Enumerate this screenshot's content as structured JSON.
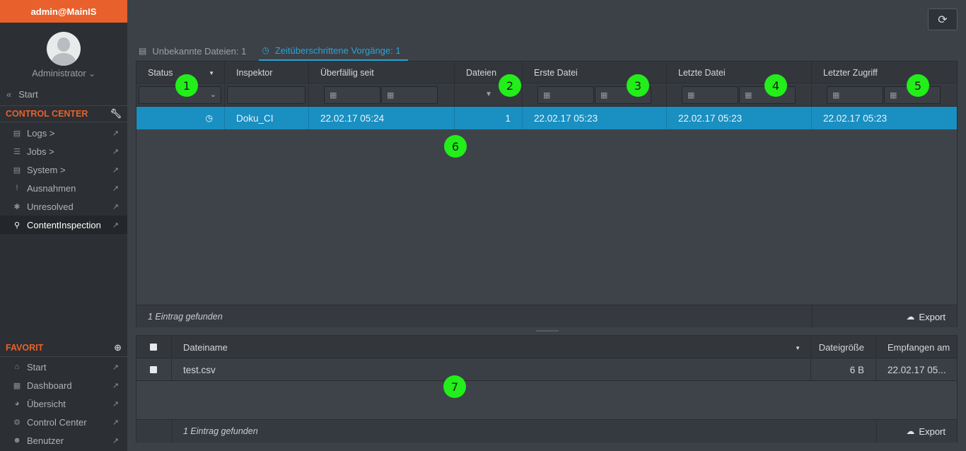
{
  "app": {
    "brand": "admin@MainIS"
  },
  "user": {
    "name": "Administrator"
  },
  "sidebar": {
    "back_label": "Start",
    "control_center_title": "CONTROL CENTER",
    "items": [
      {
        "label": "Logs",
        "chevron": ">",
        "icon": "file-icon"
      },
      {
        "label": "Jobs",
        "chevron": ">",
        "icon": "stack-icon"
      },
      {
        "label": "System",
        "chevron": ">",
        "icon": "server-icon"
      },
      {
        "label": "Ausnahmen",
        "chevron": "",
        "icon": "exclamation-icon"
      },
      {
        "label": "Unresolved",
        "chevron": "",
        "icon": "asterisk-icon"
      },
      {
        "label": "ContentInspection",
        "chevron": "",
        "icon": "search-zoom-icon",
        "active": true
      }
    ],
    "favorit_title": "FAVORIT",
    "favorites": [
      {
        "label": "Start",
        "icon": "home-icon"
      },
      {
        "label": "Dashboard",
        "icon": "grid-icon"
      },
      {
        "label": "Übersicht",
        "icon": "pie-icon"
      },
      {
        "label": "Control Center",
        "icon": "wrench-icon"
      },
      {
        "label": "Benutzer",
        "icon": "users-icon"
      }
    ]
  },
  "tabs": [
    {
      "label": "Unbekannte Dateien: 1",
      "icon": "file-icon"
    },
    {
      "label": "Zeitüberschrittene Vorgänge: 1",
      "icon": "clock-icon",
      "active": true
    }
  ],
  "grid1": {
    "columns": [
      "Status",
      "Inspektor",
      "Überfällig seit",
      "Dateien",
      "Erste Datei",
      "Letzte Datei",
      "Letzter Zugriff"
    ],
    "rows": [
      {
        "inspektor": "Doku_CI",
        "ueberfaellig": "22.02.17 05:24",
        "dateien": "1",
        "erste": "22.02.17 05:23",
        "letzte": "22.02.17 05:23",
        "zugriff": "22.02.17 05:23"
      }
    ],
    "footer": "1 Eintrag gefunden",
    "export_label": "Export"
  },
  "grid2": {
    "columns": [
      "Dateiname",
      "Dateigröße",
      "Empfangen am"
    ],
    "rows": [
      {
        "name": "test.csv",
        "size": "6 B",
        "received": "22.02.17 05..."
      }
    ],
    "footer": "1 Eintrag gefunden",
    "export_label": "Export"
  },
  "markers": [
    "1",
    "2",
    "3",
    "4",
    "5",
    "6",
    "7"
  ],
  "colors": {
    "brand": "#e8612c",
    "accent": "#2aa3d6",
    "selected_row": "#1a8fc1",
    "marker": "#22ee1a"
  }
}
